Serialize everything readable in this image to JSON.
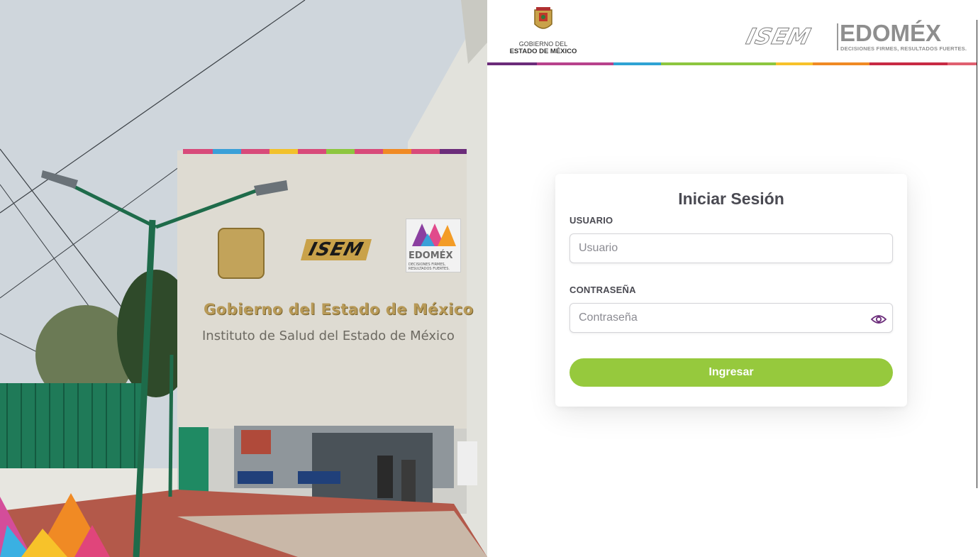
{
  "photo": {
    "wall_title": "Gobierno del Estado de México",
    "wall_subtitle": "Instituto de Salud del Estado de México",
    "wall_isem": "ISEM",
    "sign_edomex": "EDOMÉX",
    "sign_tagline": "DECISIONES FIRMES, RESULTADOS FUERTES."
  },
  "header": {
    "gov_line1": "GOBIERNO DEL",
    "gov_line2": "ESTADO DE MÉXICO",
    "isem_logo": "ISEM",
    "edomex_logo": "EDOMÉX",
    "edomex_tagline": "DECISIONES FIRMES, RESULTADOS FUERTES.",
    "color_bar": [
      "#6b2c7a",
      "#b8428c",
      "#2fa3d4",
      "#8dc63f",
      "#f7c22a",
      "#f08a24",
      "#c82a44",
      "#e06070"
    ]
  },
  "login": {
    "title": "Iniciar Sesión",
    "user_label": "USUARIO",
    "user_placeholder": "Usuario",
    "user_value": "",
    "password_label": "CONTRASEÑA",
    "password_placeholder": "Contraseña",
    "password_value": "",
    "toggle_icon": "eye-icon",
    "submit_label": "Ingresar",
    "accent_color": "#96c93d",
    "icon_color": "#6b2c7a"
  }
}
